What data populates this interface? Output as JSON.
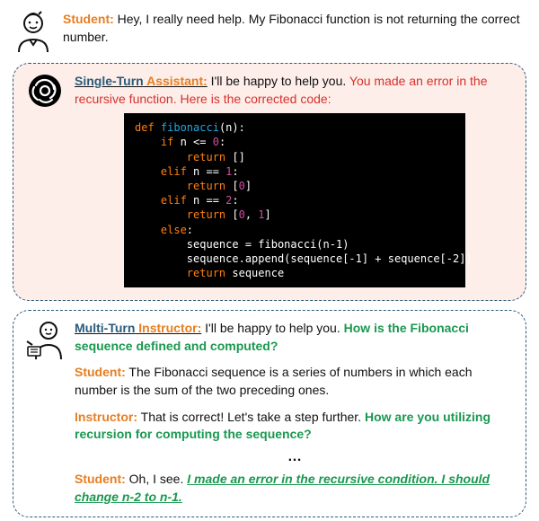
{
  "student_top": {
    "role": "Student:",
    "text": "Hey, I really need help. My Fibonacci function is not returning the correct number."
  },
  "single_turn": {
    "role_part1": "Single-Turn",
    "role_part2": " Assistant:",
    "intro": " I'll be happy to help you. ",
    "error_highlight": "You made an error in the recursive function. Here is the corrected code:",
    "code": {
      "l1a": "def ",
      "l1b": "fibonacci",
      "l1c": "(n):",
      "l2a": "    if ",
      "l2b": "n <= ",
      "l2c": "0",
      "l2d": ":",
      "l3a": "        return ",
      "l3b": "[]",
      "l4a": "    elif ",
      "l4b": "n == ",
      "l4c": "1",
      "l4d": ":",
      "l5a": "        return ",
      "l5b": "[",
      "l5c": "0",
      "l5d": "]",
      "l6a": "    elif ",
      "l6b": "n == ",
      "l6c": "2",
      "l6d": ":",
      "l7a": "        return ",
      "l7b": "[",
      "l7c": "0",
      "l7d": ", ",
      "l7e": "1",
      "l7f": "]",
      "l8a": "    else",
      "l8b": ":",
      "l9": "        sequence = fibonacci(n-1)",
      "l10": "        sequence.append(sequence[-1] + sequence[-2])",
      "l11a": "        return ",
      "l11b": "sequence"
    }
  },
  "multi_turn": {
    "role_part1": "Multi-Turn",
    "role_part2": " Instructor:",
    "intro": " I'll be happy to help you. ",
    "q1": "How is the Fibonacci sequence defined and computed?",
    "student1_role": "Student:",
    "student1_text": " The Fibonacci sequence is a series of numbers in which each number is the sum of the two preceding ones.",
    "instructor2_role": "Instructor:",
    "instructor2_text": " That is correct! Let's take a step further. ",
    "q2": "How are you utilizing recursion for computing the sequence?",
    "ellipsis": "…",
    "student3_role": "Student:",
    "student3_text": " Oh, I see. ",
    "realization": "I made an error in the recursive condition. I should change n-2 to n-1."
  }
}
